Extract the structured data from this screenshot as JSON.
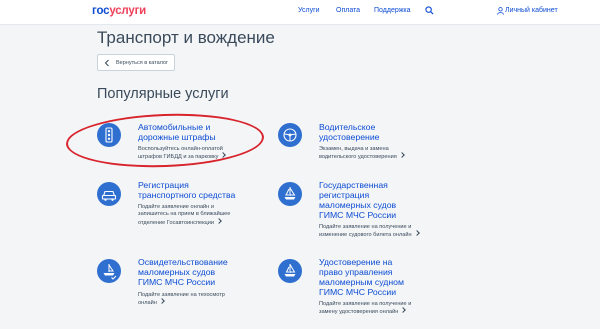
{
  "header": {
    "logo_part1": "гос",
    "logo_part2": "услуги",
    "nav": [
      {
        "label": "Услуги"
      },
      {
        "label": "Оплата"
      },
      {
        "label": "Поддержка"
      }
    ],
    "search_icon": "search-icon",
    "cabinet_label": "Личный кабинет",
    "cabinet_icon": "user-icon"
  },
  "page": {
    "title": "Транспорт и вождение",
    "back_label": "Вернуться в каталог",
    "section_title": "Популярные услуги"
  },
  "services": [
    {
      "title": "Автомобильные и\nдорожные штрафы",
      "desc": "Воспользуйтесь онлайн-оплатой\nштрафов ГИБДД и за парковку",
      "icon": "traffic-light-icon"
    },
    {
      "title": "Водительское\nудостоверение",
      "desc": "Экзамен, выдача и замена\nводительского удостоверения",
      "icon": "steering-wheel-icon"
    },
    {
      "title": "Регистрация\nтранспортного средства",
      "desc": "Подайте заявление онлайн и\nзапишитесь на прием в ближайшее\nотделение Госавтоинспекции",
      "icon": "car-icon"
    },
    {
      "title": "Государственная\nрегистрация\nмаломерных судов\nГИМС МЧС России",
      "desc": "Подайте заявление на получение и\nизменение судового билета онлайн",
      "icon": "boat-icon"
    },
    {
      "title": "Освидетельствование\nмаломерных судов\nГИМС МЧС России",
      "desc": "Подайте заявление на техосмотр\nонлайн",
      "icon": "boat-check-icon"
    },
    {
      "title": "Удостоверение на\nправо управления\nмаломерным судном\nГИМС МЧС России",
      "desc": "Подайте заявление на получение и\nзамену удостоверения онлайн",
      "icon": "sailboat-icon"
    }
  ],
  "colors": {
    "accent": "#0d4cd3",
    "logo_red": "#ee3f58",
    "icon_bg": "#2e6fd0",
    "highlight": "#d8242c"
  }
}
